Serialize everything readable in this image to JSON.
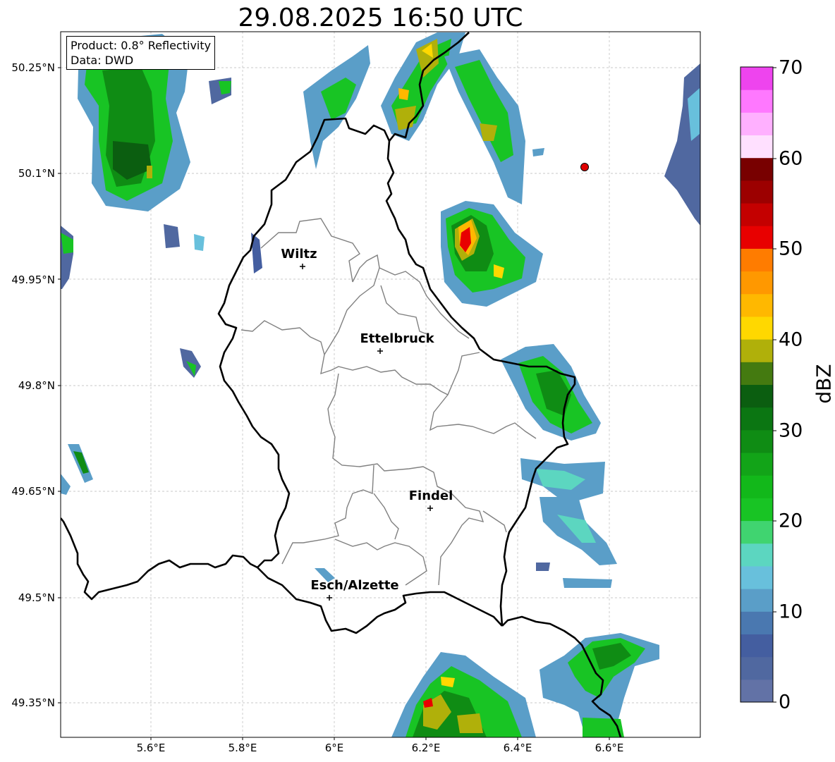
{
  "title": "29.08.2025 16:50 UTC",
  "info_box": {
    "product": "Product: 0.8° Reflectivity",
    "data": "Data: DWD"
  },
  "axes": {
    "lat_ticks": [
      "50.25°N",
      "50.1°N",
      "49.95°N",
      "49.8°N",
      "49.65°N",
      "49.5°N",
      "49.35°N"
    ],
    "lon_ticks": [
      "5.6°E",
      "5.8°E",
      "6°E",
      "6.2°E",
      "6.4°E",
      "6.6°E"
    ]
  },
  "cities": [
    {
      "name": "Wiltz",
      "lon": 5.93,
      "lat": 49.97
    },
    {
      "name": "Ettelbruck",
      "lon": 6.1,
      "lat": 49.85
    },
    {
      "name": "Findel",
      "lon": 6.21,
      "lat": 49.63
    },
    {
      "name": "Esch/Alzette",
      "lon": 5.99,
      "lat": 49.5
    }
  ],
  "radar_marker": {
    "lon": 6.55,
    "lat": 50.11
  },
  "colorbar": {
    "label": "dBZ",
    "ticks": [
      "0",
      "10",
      "20",
      "30",
      "40",
      "50",
      "60",
      "70"
    ],
    "colors": [
      "#6272a6",
      "#5068a0",
      "#445ea0",
      "#4a78b0",
      "#5a9ec8",
      "#68c0dc",
      "#5cd6c0",
      "#40d470",
      "#18c424",
      "#12b81a",
      "#12a418",
      "#0f8c14",
      "#0b7612",
      "#0b5e10",
      "#447a10",
      "#b0b00a",
      "#ffd800",
      "#ffb800",
      "#ff9800",
      "#ff7c00",
      "#e80000",
      "#c40000",
      "#9c0000",
      "#780000",
      "#ffe0ff",
      "#ffb0ff",
      "#ff78ff",
      "#ee44ee"
    ]
  }
}
